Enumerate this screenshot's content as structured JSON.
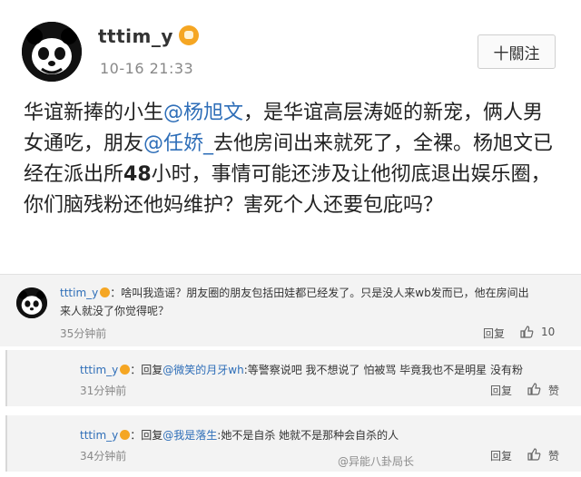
{
  "post": {
    "username": "tttim_y",
    "timestamp": "10-16 21:33",
    "follow_label": "十關注",
    "text_segments": [
      "华谊新捧的小生",
      "@杨旭文",
      "，是华谊高层涛姬的新宠，俩人男女通吃，朋友",
      "@任娇_",
      "去他房间出来就死了，全裸。杨旭文已经在派出所",
      "48",
      "小时，事情可能还涉及让他彻底退出娱乐圈，你们脑残粉还他妈维护？害死个人还要包庇吗？"
    ]
  },
  "comments": [
    {
      "username": "tttim_y",
      "line1": "：啥叫我造谣？朋友圈的朋友包括田娃都已经发了。只是没人来wb发而已，他在房间出",
      "line2": "来人就没了你觉得呢？",
      "time": "35分钟前",
      "reply_label": "回复",
      "like_count": "10"
    },
    {
      "username": "tttim_y",
      "prefix": "：回复",
      "mention": "@微笑的月牙wh",
      "text": ":等警察说吧 我不想说了 怕被骂 毕竟我也不是明星 没有粉",
      "time": "31分钟前",
      "reply_label": "回复",
      "like_label": "赞"
    },
    {
      "username": "tttim_y",
      "prefix": "：回复",
      "mention": "@我是落生",
      "text": ":她不是自杀 她就不是那种会自杀的人",
      "time": "34分钟前",
      "reply_label": "回复",
      "like_label": "赞"
    }
  ],
  "watermark": "@异能八卦局长",
  "icons": {
    "avatar": "panda-avatar",
    "verified": "vip-badge-icon",
    "like": "thumbs-up-icon"
  }
}
